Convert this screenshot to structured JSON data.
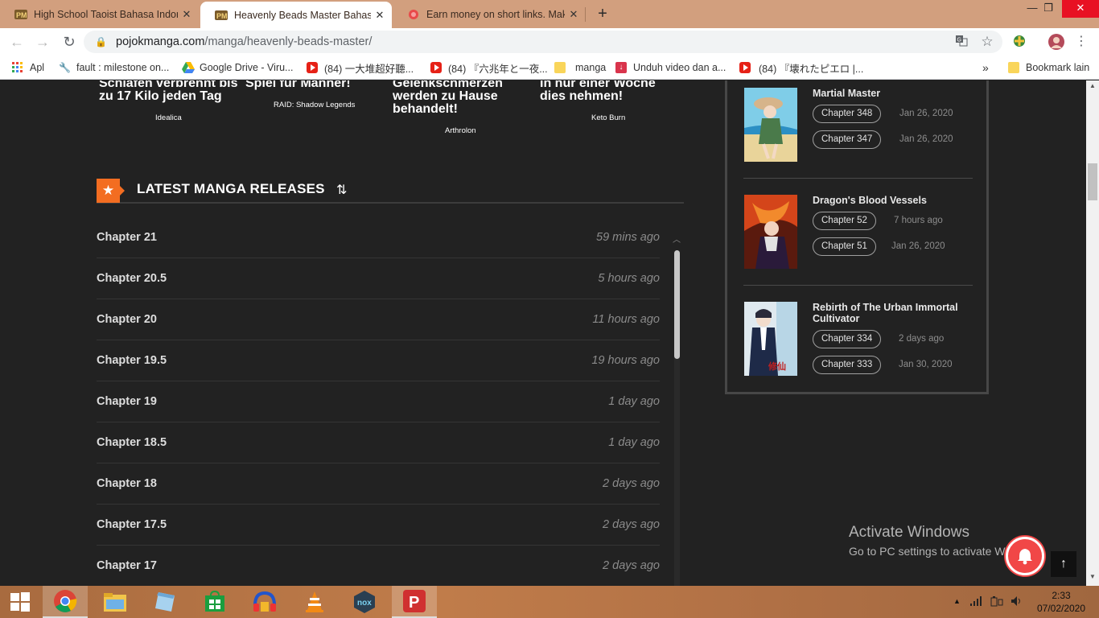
{
  "browser": {
    "tabs": [
      {
        "title": "High School Taoist Bahasa Indonesia",
        "close": "✕"
      },
      {
        "title": "Heavenly Beads Master Bahasa Indonesia",
        "close": "✕"
      },
      {
        "title": "Earn money on short links. Make",
        "close": "✕"
      }
    ],
    "new_tab": "+",
    "url_host": "pojokmanga.com",
    "url_path": "/manga/heavenly-beads-master/",
    "bookmarks": [
      {
        "label": "Apl"
      },
      {
        "label": "fault : milestone on..."
      },
      {
        "label": "Google Drive - Viru..."
      },
      {
        "label": "(84) 一大堆超好聽..."
      },
      {
        "label": "(84) 『六兆年と一夜..."
      },
      {
        "label": "manga"
      },
      {
        "label": "Unduh video dan a..."
      },
      {
        "label": "(84) 『壊れたピエロ |..."
      }
    ],
    "bookmarks_more": "»",
    "other_bookmarks": "Bookmark lain"
  },
  "ads": [
    {
      "text": "Schlafen verbrennt bis zu 17 Kilo jeden Tag",
      "source": "Idealica"
    },
    {
      "text": "Spiel für Männer!",
      "source": "RAID: Shadow Legends"
    },
    {
      "text": "Gelenkschmerzen werden zu Hause behandelt!",
      "source": "Arthrolon"
    },
    {
      "text": "In nur einer Woche dies nehmen!",
      "source": "Keto Burn"
    }
  ],
  "latest": {
    "title": "LATEST MANGA RELEASES",
    "chapters": [
      {
        "name": "Chapter 21",
        "time": "59 mins ago"
      },
      {
        "name": "Chapter 20.5",
        "time": "5 hours ago"
      },
      {
        "name": "Chapter 20",
        "time": "11 hours ago"
      },
      {
        "name": "Chapter 19.5",
        "time": "19 hours ago"
      },
      {
        "name": "Chapter 19",
        "time": "1 day ago"
      },
      {
        "name": "Chapter 18.5",
        "time": "1 day ago"
      },
      {
        "name": "Chapter 18",
        "time": "2 days ago"
      },
      {
        "name": "Chapter 17.5",
        "time": "2 days ago"
      },
      {
        "name": "Chapter 17",
        "time": "2 days ago"
      }
    ]
  },
  "sidebar": {
    "manga": [
      {
        "title": "Martial Master",
        "chapters": [
          {
            "label": "Chapter 348",
            "date": "Jan 26, 2020"
          },
          {
            "label": "Chapter 347",
            "date": "Jan 26, 2020"
          }
        ]
      },
      {
        "title": "Dragon's Blood Vessels",
        "chapters": [
          {
            "label": "Chapter 52",
            "date": "7 hours ago"
          },
          {
            "label": "Chapter 51",
            "date": "Jan 26, 2020"
          }
        ]
      },
      {
        "title": "Rebirth of The Urban Immortal Cultivator",
        "chapters": [
          {
            "label": "Chapter 334",
            "date": "2 days ago"
          },
          {
            "label": "Chapter 333",
            "date": "Jan 30, 2020"
          }
        ]
      }
    ]
  },
  "watermark": {
    "line1": "Activate Windows",
    "line2": "Go to PC settings to activate Windows."
  },
  "taskbar": {
    "time": "2:33",
    "date": "07/02/2020"
  }
}
